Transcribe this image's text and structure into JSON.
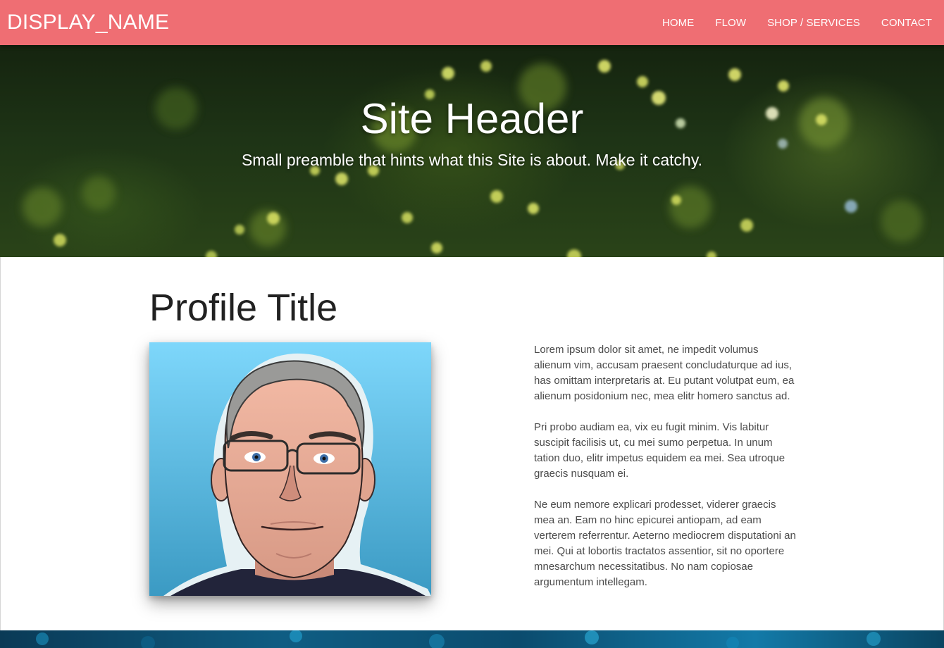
{
  "navbar": {
    "brand": "DISPLAY_NAME",
    "links": [
      "HOME",
      "FLOW",
      "SHOP / SERVICES",
      "CONTACT"
    ],
    "background_color": "#ef6e73"
  },
  "hero": {
    "title": "Site Header",
    "subtitle": "Small preamble that hints what this Site is about. Make it catchy."
  },
  "profile": {
    "title": "Profile Title",
    "avatar": "cartoon-portrait-icon",
    "paragraphs": [
      "Lorem ipsum dolor sit amet, ne impedit volumus alienum vim, accusam praesent concludaturque ad ius, has omittam interpretaris at. Eu putant volutpat eum, ea alienum posidonium nec, mea elitr homero sanctus ad.",
      "Pri probo audiam ea, vix eu fugit minim. Vis labitur suscipit facilisis ut, cu mei sumo perpetua. In unum tation duo, elitr impetus equidem ea mei. Sea utroque graecis nusquam ei.",
      "Ne eum nemore explicari prodesset, viderer graecis mea an. Eam no hinc epicurei antiopam, ad eam verterem referrentur. Aeterno mediocrem disputationi an mei. Qui at lobortis tractatos assentior, sit no oportere mnesarchum necessitatibus. No nam copiosae argumentum intellegam."
    ]
  }
}
